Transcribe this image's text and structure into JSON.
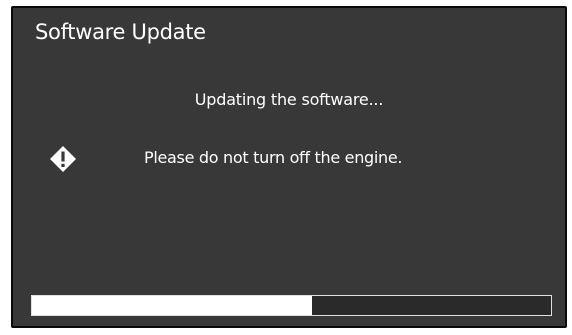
{
  "dialog": {
    "title": "Software Update",
    "status": "Updating the software...",
    "warning": {
      "icon": "warning-diamond-icon",
      "text": "Please do not turn off the engine."
    },
    "progress": {
      "fraction": 0.54
    }
  },
  "colors": {
    "background": "#383838",
    "text": "#ffffff",
    "progress_fill": "#ffffff",
    "progress_track": "#2a2a2a"
  }
}
